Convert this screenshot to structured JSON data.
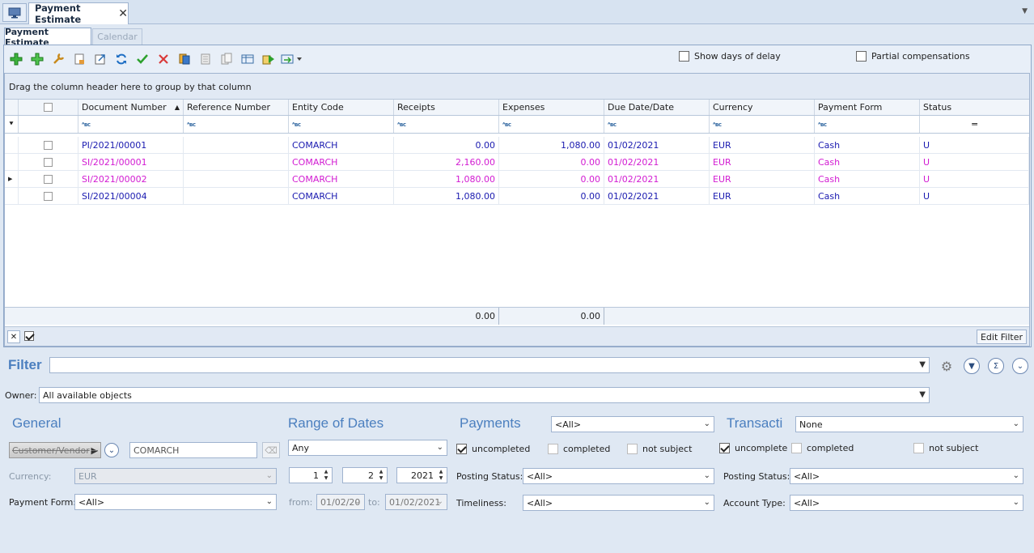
{
  "window": {
    "tab_title": "Payment Estimate",
    "close_glyph": "✕"
  },
  "tabs": [
    {
      "label": "Payment Estimate"
    },
    {
      "label": "Calendar"
    }
  ],
  "toolbar": {
    "show_days_delay_label": "Show days of delay",
    "partial_comp_label": "Partial compensations"
  },
  "grid": {
    "group_hint": "Drag the column header here to group by that column",
    "columns": [
      "Document Number",
      "Reference Number",
      "Entity Code",
      "Receipts",
      "Expenses",
      "Due Date/Date",
      "Currency",
      "Payment Form",
      "Status"
    ],
    "rows": [
      {
        "doc": "PI/2021/00001",
        "ref": "",
        "entity": "COMARCH",
        "receipts": "0.00",
        "expenses": "1,080.00",
        "date": "01/02/2021",
        "currency": "EUR",
        "form": "Cash",
        "status": "U",
        "color": "#1a1ab0"
      },
      {
        "doc": "SI/2021/00001",
        "ref": "",
        "entity": "COMARCH",
        "receipts": "2,160.00",
        "expenses": "0.00",
        "date": "01/02/2021",
        "currency": "EUR",
        "form": "Cash",
        "status": "U",
        "color": "#d21bd2"
      },
      {
        "doc": "SI/2021/00002",
        "ref": "",
        "entity": "COMARCH",
        "receipts": "1,080.00",
        "expenses": "0.00",
        "date": "01/02/2021",
        "currency": "EUR",
        "form": "Cash",
        "status": "U",
        "color": "#d21bd2"
      },
      {
        "doc": "SI/2021/00004",
        "ref": "",
        "entity": "COMARCH",
        "receipts": "1,080.00",
        "expenses": "0.00",
        "date": "01/02/2021",
        "currency": "EUR",
        "form": "Cash",
        "status": "U",
        "color": "#1a1ab0"
      }
    ],
    "footer_receipts": "0.00",
    "footer_expenses": "0.00",
    "edit_filter_label": "Edit Filter"
  },
  "filter": {
    "title": "Filter",
    "owner_label": "Owner:",
    "owner_value": "All available objects"
  },
  "general": {
    "title": "General",
    "customer_button": "Customer/Vendor",
    "customer_value": "COMARCH",
    "currency_label": "Currency:",
    "currency_value": "EUR",
    "payment_form_label": "Payment Form:",
    "payment_form_value": "<All>"
  },
  "dates": {
    "title": "Range of Dates",
    "range_value": "Any",
    "day": "1",
    "month": "2",
    "year": "2021",
    "from_label": "from:",
    "from_value": "01/02/20",
    "to_label": "to:",
    "to_value": "01/02/2021"
  },
  "payments": {
    "title": "Payments",
    "select_value": "<All>",
    "uncompleted": "uncompleted",
    "completed": "completed",
    "not_subject": "not subject",
    "posting_label": "Posting Status:",
    "posting_value": "<All>",
    "timeliness_label": "Timeliness:",
    "timeliness_value": "<All>"
  },
  "transactions": {
    "title": "Transacti",
    "select_value": "None",
    "uncomplete": "uncomplete",
    "completed": "completed",
    "not_subject": "not subject",
    "posting_label": "Posting Status:",
    "posting_value": "<All>",
    "account_label": "Account Type:",
    "account_value": "<All>"
  }
}
